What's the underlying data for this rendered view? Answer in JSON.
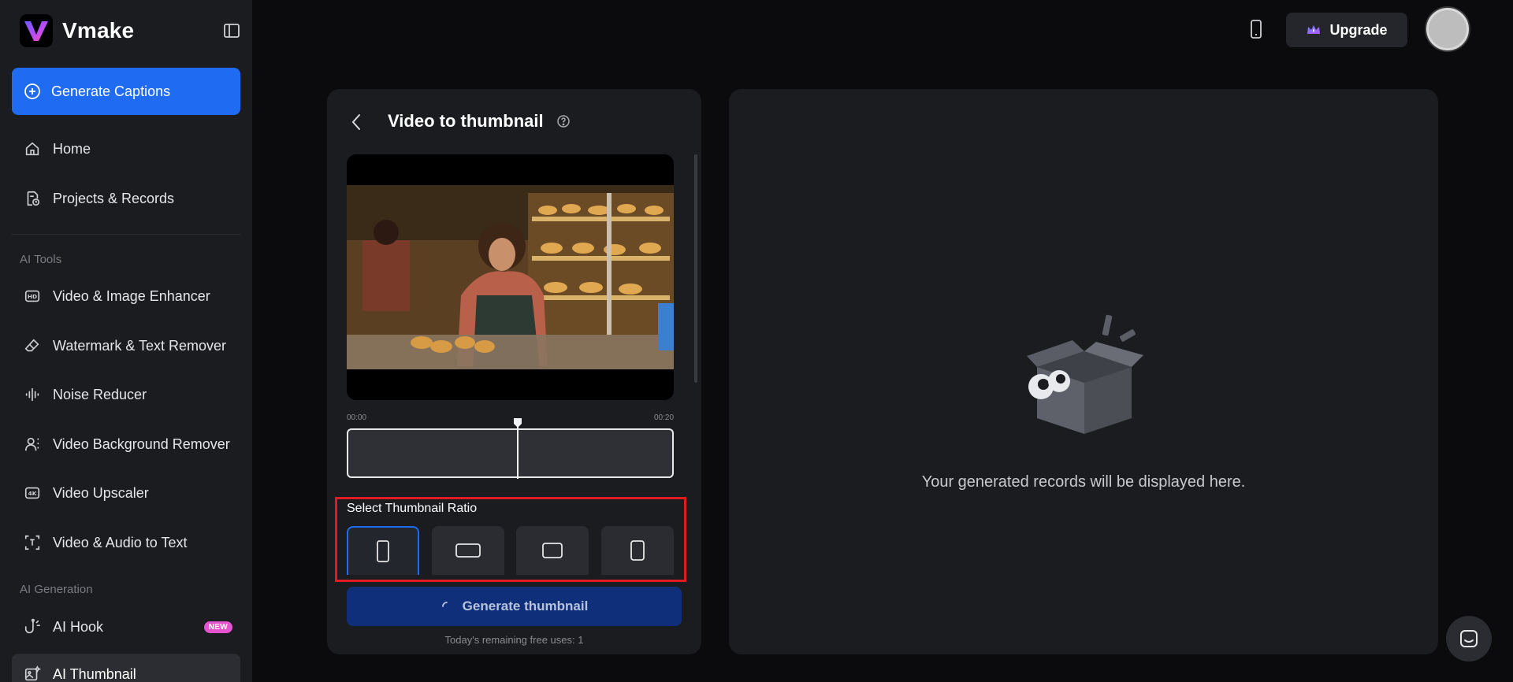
{
  "brand": {
    "name": "Vmake"
  },
  "sidebar": {
    "generate_captions": "Generate Captions",
    "items": [
      {
        "label": "Home"
      },
      {
        "label": "Projects & Records"
      }
    ],
    "section_ai_tools": "AI Tools",
    "ai_tools": [
      {
        "label": "Video & Image Enhancer"
      },
      {
        "label": "Watermark & Text Remover"
      },
      {
        "label": "Noise Reducer"
      },
      {
        "label": "Video Background Remover"
      },
      {
        "label": "Video Upscaler"
      },
      {
        "label": "Video & Audio to Text"
      }
    ],
    "section_ai_generation": "AI Generation",
    "ai_generation": [
      {
        "label": "AI Hook",
        "badge": "NEW"
      },
      {
        "label": "AI Thumbnail"
      }
    ]
  },
  "topbar": {
    "upgrade_label": "Upgrade"
  },
  "tool": {
    "title": "Video to thumbnail",
    "time_start": "00:00",
    "time_end": "00:20",
    "ratio_label": "Select Thumbnail Ratio",
    "generate_label": "Generate thumbnail",
    "free_uses": "Today's remaining free uses: 1"
  },
  "records": {
    "empty_message": "Your generated records will be displayed here."
  },
  "colors": {
    "accent": "#1f6bf2",
    "highlight": "#e01b24",
    "badge": "#e653d0"
  }
}
